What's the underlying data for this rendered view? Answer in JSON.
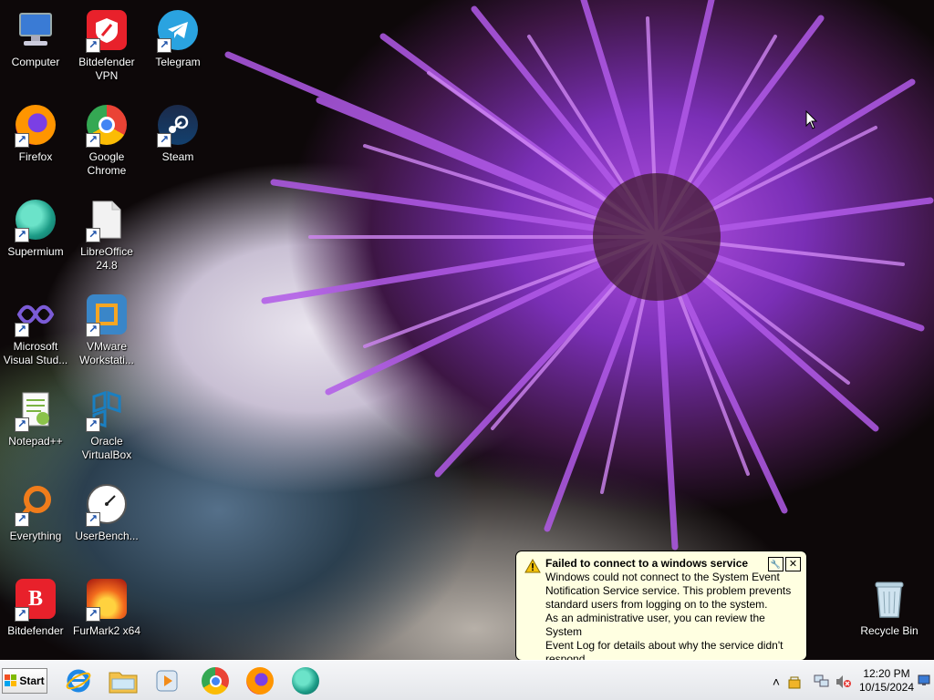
{
  "desktop": {
    "icons": [
      {
        "label": "Computer",
        "icon": "computer-icon"
      },
      {
        "label": "Bitdefender VPN",
        "icon": "bitdefender-vpn-icon"
      },
      {
        "label": "Telegram",
        "icon": "telegram-icon"
      },
      {
        "label": "Firefox",
        "icon": "firefox-icon"
      },
      {
        "label": "Google Chrome",
        "icon": "chrome-icon"
      },
      {
        "label": "Steam",
        "icon": "steam-icon"
      },
      {
        "label": "Supermium",
        "icon": "supermium-icon"
      },
      {
        "label": "LibreOffice 24.8",
        "icon": "libreoffice-icon"
      },
      {
        "label": "Microsoft Visual Stud...",
        "icon": "visual-studio-icon"
      },
      {
        "label": "VMware Workstati...",
        "icon": "vmware-icon"
      },
      {
        "label": "Notepad++",
        "icon": "notepadpp-icon"
      },
      {
        "label": "Oracle VirtualBox",
        "icon": "virtualbox-icon"
      },
      {
        "label": "Everything",
        "icon": "everything-icon"
      },
      {
        "label": "UserBench...",
        "icon": "userbenchmark-icon"
      },
      {
        "label": "Bitdefender",
        "icon": "bitdefender-icon"
      },
      {
        "label": "FurMark2 x64",
        "icon": "furmark-icon"
      },
      {
        "label": "Recycle Bin",
        "icon": "recycle-bin-icon"
      }
    ]
  },
  "notification": {
    "title": "Failed to connect to a windows service",
    "lines": [
      "Windows could not connect to the System Event",
      "Notification Service service. This problem prevents",
      "standard users from logging on to the system.",
      "As an administrative user, you can review the System",
      "Event Log for details about why the service didn't",
      "respond"
    ],
    "options_glyph": "🔧",
    "close_glyph": "✕"
  },
  "taskbar": {
    "start_label": "Start",
    "pinned": [
      "internet-explorer-icon",
      "file-explorer-icon",
      "media-player-icon",
      "chrome-icon",
      "firefox-icon",
      "supermium-icon"
    ],
    "tray": {
      "expand_glyph": "˄",
      "time": "12:20 PM",
      "date": "10/15/2024"
    }
  },
  "colors": {
    "balloon_bg": "#ffffe1",
    "taskbar_bg": "#eceef1",
    "accent_purple": "#9b3fd6"
  }
}
